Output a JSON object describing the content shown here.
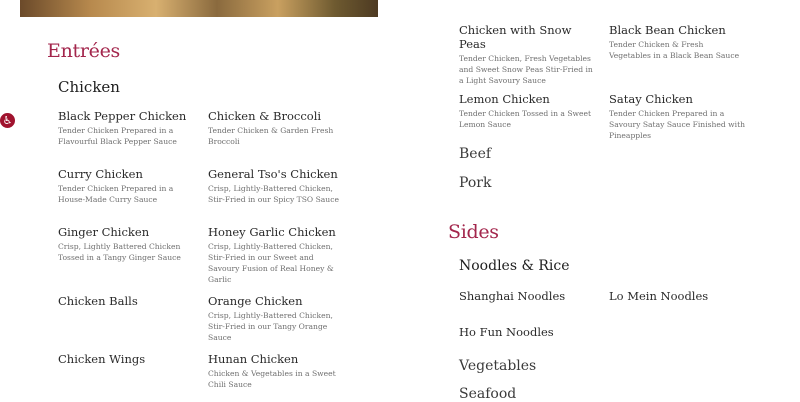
{
  "accessibility": {
    "icon": "♿"
  },
  "entrees": {
    "title": "Entrées",
    "chicken": {
      "title": "Chicken",
      "items": [
        {
          "name": "Black Pepper Chicken",
          "desc": "Tender Chicken Prepared in a Flavourful Black Pepper Sauce"
        },
        {
          "name": "Chicken & Broccoli",
          "desc": "Tender Chicken & Garden Fresh Broccoli"
        },
        {
          "name": "Curry Chicken",
          "desc": "Tender Chicken Prepared in a House-Made Curry Sauce"
        },
        {
          "name": "General Tso's Chicken",
          "desc": "Crisp, Lightly-Battered Chicken, Stir-Fried in our Spicy TSO Sauce"
        },
        {
          "name": "Ginger Chicken",
          "desc": "Crisp, Lightly Battered Chicken Tossed in a Tangy Ginger Sauce"
        },
        {
          "name": "Honey Garlic Chicken",
          "desc": "Crisp, Lightly-Battered Chicken, Stir-Fried in our Sweet and Savoury Fusion of Real Honey & Garlic"
        },
        {
          "name": "Chicken Balls",
          "desc": ""
        },
        {
          "name": "Orange Chicken",
          "desc": "Crisp, Lightly-Battered Chicken, Stir-Fried in our Tangy Orange Sauce"
        },
        {
          "name": "Chicken Wings",
          "desc": ""
        },
        {
          "name": "Hunan Chicken",
          "desc": "Chicken & Vegetables in a Sweet Chili Sauce"
        }
      ],
      "right_items": [
        {
          "name": "Chicken with Snow Peas",
          "desc": "Tender Chicken, Fresh Vegetables and Sweet Snow Peas Stir-Fried in a Light Savoury Sauce"
        },
        {
          "name": "Black Bean Chicken",
          "desc": "Tender Chicken & Fresh Vegetables in a Black Bean Sauce"
        },
        {
          "name": "Lemon Chicken",
          "desc": "Tender Chicken Tossed in a Sweet Lemon Sauce"
        },
        {
          "name": "Satay Chicken",
          "desc": "Tender Chicken Prepared in a Savoury Satay Sauce Finished with Pineapples"
        }
      ]
    },
    "beef": "Beef",
    "pork": "Pork"
  },
  "sides": {
    "title": "Sides",
    "noodles": {
      "title": "Noodles & Rice",
      "items": [
        "Shanghai Noodles",
        "Lo Mein Noodles",
        "Ho Fun Noodles"
      ]
    },
    "vegetables": "Vegetables",
    "seafood": "Seafood"
  }
}
